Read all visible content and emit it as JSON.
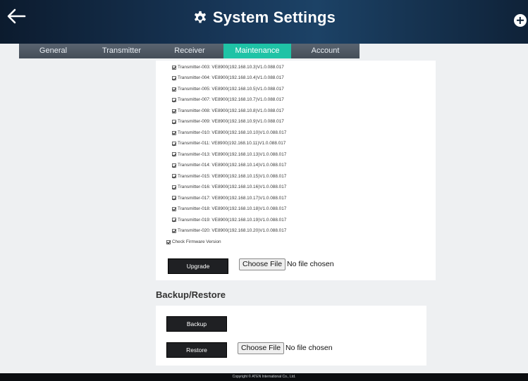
{
  "header": {
    "title": "System Settings",
    "back_icon": "arrow-left-icon",
    "gear_icon": "gear-icon",
    "add_icon": "plus-circle-icon"
  },
  "tabs": [
    {
      "label": "General",
      "active": false
    },
    {
      "label": "Transmitter",
      "active": false
    },
    {
      "label": "Receiver",
      "active": false
    },
    {
      "label": "Maintenance",
      "active": true
    },
    {
      "label": "Account",
      "active": false
    }
  ],
  "firmware": {
    "devices": [
      "Transmitter-003: VE8900(192.168.10.3)V1.0.088.017",
      "Transmitter-004: VE8900(192.168.10.4)V1.0.088.017",
      "Transmitter-005: VE8900(192.168.10.5)V1.0.088.017",
      "Transmitter-007: VE8900(192.168.10.7)V1.0.088.017",
      "Transmitter-008: VE8900(192.168.10.8)V1.0.088.017",
      "Transmitter-009: VE8900(192.168.10.9)V1.0.088.017",
      "Transmitter-010: VE8900(192.168.10.10)V1.0.088.017",
      "Transmitter-011: VE8900(192.168.10.11)V1.0.088.017",
      "Transmitter-013: VE8900(192.168.10.13)V1.0.088.017",
      "Transmitter-014: VE8900(192.168.10.14)V1.0.088.017",
      "Transmitter-015: VE8900(192.168.10.15)V1.0.088.017",
      "Transmitter-016: VE8900(192.168.10.16)V1.0.088.017",
      "Transmitter-017: VE8900(192.168.10.17)V1.0.088.017",
      "Transmitter-018: VE8900(192.168.10.18)V1.0.088.017",
      "Transmitter-019: VE8900(192.168.10.19)V1.0.088.017",
      "Transmitter-020: VE8900(192.168.10.20)V1.0.088.017"
    ],
    "check_firmware_label": "Check Firmware Version",
    "upgrade_label": "Upgrade",
    "choose_file_label": "Choose File",
    "no_file_text": "No file chosen"
  },
  "backup_restore": {
    "title": "Backup/Restore",
    "backup_label": "Backup",
    "restore_label": "Restore",
    "choose_file_label": "Choose File",
    "no_file_text": "No file chosen"
  },
  "footer": {
    "copyright": "Copyright © ATEN International Co., Ltd."
  },
  "colors": {
    "active_tab": "#1fc3a6",
    "header": "#18385a",
    "button": "#1f2023"
  }
}
